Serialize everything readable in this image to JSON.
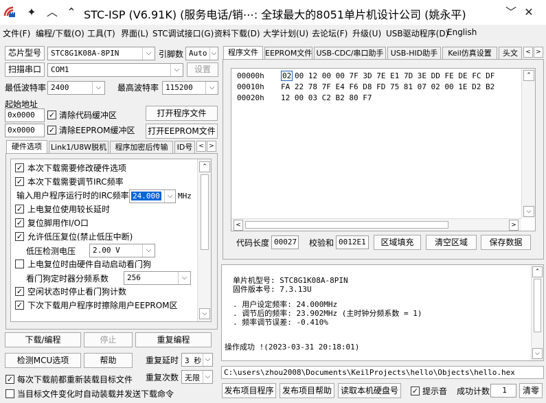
{
  "window": {
    "title": "STC-ISP (V6.91K) (服务电话/销⋯: 全球最大的8051单片机设计公司 (姚永平)",
    "controls": [
      "pin-icon",
      "collapse-icon",
      "expand-icon",
      "chevron-down-icon",
      "minimize-icon",
      "close-icon"
    ]
  },
  "menu": [
    "文件(F)",
    "编程/下载(O)",
    "工具(T)",
    "界面(L)",
    "STC调试接口(G)",
    "资料下载(D)",
    "大学计划(U)",
    "去论坛(F)",
    "升级(U)",
    "USB驱动程序(D)",
    "English"
  ],
  "left": {
    "chip_label": "芯片型号",
    "chip_value": "STC8G1K08A-8PIN",
    "pin_label": "引脚数",
    "pin_value": "Auto",
    "scan_label": "扫描串口",
    "port_value": "COM1",
    "settings_button": "设置",
    "min_baud_label": "最低波特率",
    "min_baud_value": "2400",
    "max_baud_label": "最高波特率",
    "max_baud_value": "115200",
    "start_addr_label": "起始地址",
    "code_addr": "0x0000",
    "clear_code_label": "清除代码缓冲区",
    "open_program_button": "打开程序文件",
    "eeprom_addr": "0x0000",
    "clear_eeprom_label": "清除EEPROM缓冲区",
    "open_eeprom_button": "打开EEPROM文件",
    "tabs": [
      "硬件选项",
      "Link1/U8W脱机",
      "程序加密后传输",
      "ID号"
    ],
    "options": {
      "opt1": "本次下载需要修改硬件选项",
      "opt2": "本次下载需要调节IRC频率",
      "irc_label": "输入用户程序运行时的IRC频率",
      "irc_value": "24.000",
      "irc_unit": "MHz",
      "opt3": "上电复位使用较长延时",
      "opt4": "复位脚用作I/O口",
      "opt5": "允许低压复位(禁止低压中断)",
      "lvd_label": "低压检测电压",
      "lvd_value": "2.00 V",
      "opt6": "上电复位时由硬件自动启动看门狗",
      "wdt_label": "看门狗定时器分频系数",
      "wdt_value": "256",
      "opt7": "空闲状态时停止看门狗计数",
      "opt8": "下次下载用户程序时擦除用户EEPROM区"
    },
    "download_button": "下载/编程",
    "stop_button": "停止",
    "reprogram_button": "重复编程",
    "detect_button": "检测MCU选项",
    "help_button": "帮助",
    "repeat_delay_label": "重复延时",
    "repeat_delay_value": "3 秒",
    "repeat_count_label": "重复次数",
    "repeat_count_value": "无限",
    "reload_label": "每次下载前都重新装载目标文件",
    "auto_send_label": "当目标文件变化时自动装载并发送下载命令"
  },
  "right": {
    "tabs": [
      "程序文件",
      "EEPROM文件",
      "USB-CDC/串口助手",
      "USB-HID助手",
      "Keil仿真设置",
      "头文"
    ],
    "hex_lines": [
      {
        "addr": "00000h",
        "first": "02",
        "bytes": "00 12 00 00 7F 3D 7E E1 7D 3E DD FE DE FC DF"
      },
      {
        "addr": "00010h",
        "first": "",
        "bytes": "FA 22 78 7F E4 F6 D8 FD 75 81 07 02 00 1E D2 B2"
      },
      {
        "addr": "00020h",
        "first": "",
        "bytes": "12 00 03 C2 B2 80 F7"
      }
    ],
    "code_len_label": "代码长度",
    "code_len_value": "00027",
    "checksum_label": "校验和",
    "checksum_value": "0012E1",
    "fill_button": "区域填充",
    "clear_button": "清空区域",
    "save_button": "保存数据",
    "info": {
      "line1": "单片机型号: STC8G1K08A-8PIN",
      "line2": "固件版本号: 7.3.13U",
      "line3": ". 用户设定频率: 24.000MHz",
      "line4": ". 调节后的频率: 23.902MHz (主时钟分频系数 = 1)",
      "line5": ". 频率调节误差: -0.410%",
      "line6": "操作成功 !(2023-03-31 20:18:01)"
    },
    "file_path": "C:\\users\\zhou2008\\Documents\\KeilProjects\\hello\\Objects\\hello.hex",
    "publish_program_button": "发布项目程序",
    "publish_help_button": "发布项目帮助",
    "read_serial_button": "读取本机硬盘号",
    "beep_label": "提示音",
    "success_count_label": "成功计数",
    "success_count_value": "1",
    "clear_count_button": "清零"
  }
}
